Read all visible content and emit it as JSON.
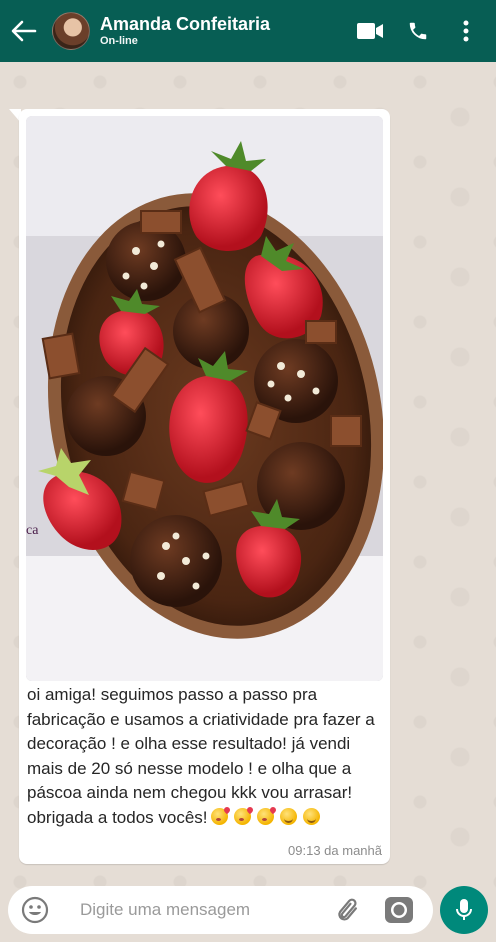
{
  "header": {
    "contact_name": "Amanda Confeitaria",
    "status": "On-line",
    "back_icon": "arrow-left-icon",
    "video_icon": "video-call-icon",
    "call_icon": "phone-icon",
    "menu_icon": "more-vertical-icon",
    "background": "#075e54"
  },
  "message": {
    "image_alt": "chocolate easter egg decorated with strawberries and brigadeiros",
    "caption": "oi amiga! seguimos passo a passo pra fabricação e usamos a criatividade pra fazer a decoração ! e olha esse resultado! já vendi mais de 20 só nesse modelo ! e olha que a páscoa ainda nem chegou kkk vou arrasar! obrigada a todos vocês!",
    "emojis": [
      "face-blowing-kiss",
      "face-blowing-kiss",
      "face-blowing-kiss",
      "smiling-face",
      "smiling-face"
    ],
    "timestamp": "09:13 da manhã"
  },
  "composer": {
    "placeholder": "Digite uma mensagem",
    "emoji_icon": "emoji-icon",
    "attach_icon": "paperclip-icon",
    "camera_icon": "camera-icon",
    "mic_icon": "microphone-icon",
    "mic_color": "#00897b"
  }
}
